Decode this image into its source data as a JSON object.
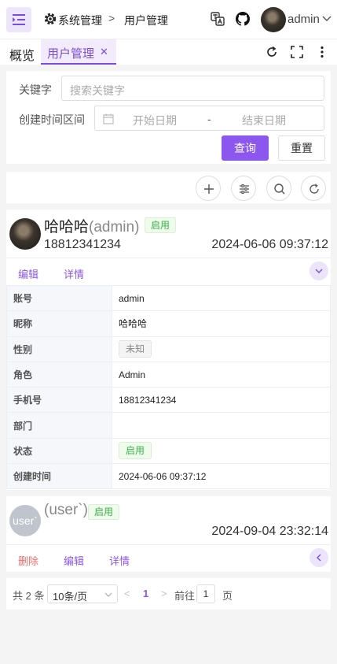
{
  "header": {
    "breadcrumb_root": "系统管理",
    "breadcrumb_current": "用户管理",
    "username": "admin",
    "icons": [
      "menu-fold-icon",
      "gear-icon",
      "translate-icon",
      "github-icon",
      "chevron-down-icon"
    ]
  },
  "tabs": {
    "overview": "概览",
    "active": "用户管理",
    "close": "✕",
    "tools": [
      "refresh-icon",
      "fullscreen-icon",
      "more-vertical-icon"
    ]
  },
  "search": {
    "keyword_label": "关键字",
    "keyword_placeholder": "搜索关键字",
    "date_label": "创建时间区间",
    "start_placeholder": "开始日期",
    "date_sep": "-",
    "end_placeholder": "结束日期",
    "query_btn": "查询",
    "reset_btn": "重置"
  },
  "toolbar": {
    "buttons": [
      "add-icon",
      "filter-settings-icon",
      "search-icon",
      "refresh-icon"
    ]
  },
  "users": [
    {
      "nickname": "哈哈哈",
      "account_paren": "(admin)",
      "status": "启用",
      "phone": "18812341234",
      "created": "2024-06-06 09:37:12",
      "actions": [
        "编辑",
        "详情"
      ],
      "details": [
        {
          "k": "账号",
          "v": "admin"
        },
        {
          "k": "昵称",
          "v": "哈哈哈"
        },
        {
          "k": "性别",
          "v": "未知"
        },
        {
          "k": "角色",
          "v": "Admin"
        },
        {
          "k": "手机号",
          "v": "18812341234"
        },
        {
          "k": "部门",
          "v": ""
        },
        {
          "k": "状态",
          "v": "启用"
        },
        {
          "k": "创建时间",
          "v": "2024-06-06 09:37:12"
        }
      ]
    },
    {
      "avatar_text": "user`",
      "account_paren": "(user`)",
      "status": "启用",
      "created": "2024-09-04 23:32:14",
      "actions": [
        "删除",
        "编辑",
        "详情"
      ]
    }
  ],
  "pagination": {
    "total": "共 2 条",
    "page_size": "10条/页",
    "prev": "<",
    "current_page": "1",
    "next": ">",
    "goto_label": "前往",
    "goto_value": "1",
    "page_suffix": "页"
  },
  "colors": {
    "accent": "#8c57ee",
    "success": "#3bb34a",
    "danger": "#f56c6c"
  }
}
